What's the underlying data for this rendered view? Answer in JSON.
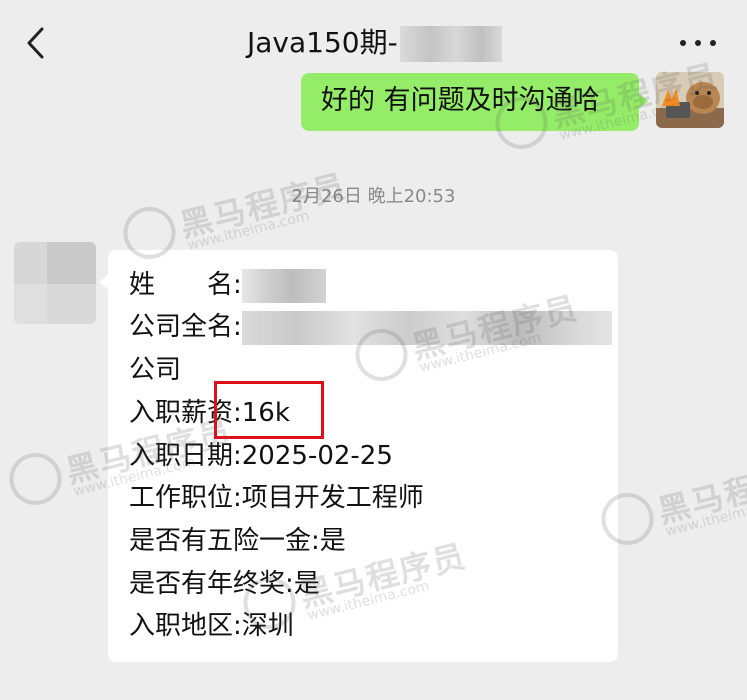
{
  "header": {
    "title": "Java150期-",
    "back_icon": "chevron-left-icon",
    "more_icon": "more-dots-icon"
  },
  "outgoing": {
    "text": "好的 有问题及时沟通哈",
    "bubble_color": "#95ec69"
  },
  "timestamp": "2月26日 晚上20:53",
  "incoming": {
    "lines": [
      {
        "label": "姓　　名:",
        "value": ""
      },
      {
        "label": "公司全名:",
        "value": ""
      },
      {
        "label": "公司",
        "value": ""
      },
      {
        "label": "入职薪资:",
        "value": "16k"
      },
      {
        "label": "入职日期:",
        "value": "2025-02-25"
      },
      {
        "label": "工作职位:",
        "value": "项目开发工程师"
      },
      {
        "label": "是否有五险一金:",
        "value": "是"
      },
      {
        "label": "是否有年终奖:",
        "value": "是"
      },
      {
        "label": "入职地区:",
        "value": "深圳"
      }
    ]
  },
  "watermark": {
    "cn": "黑马程序员",
    "en": "www.itheima.com"
  },
  "colors": {
    "background": "#ededed",
    "highlight_box": "#e0101b"
  }
}
